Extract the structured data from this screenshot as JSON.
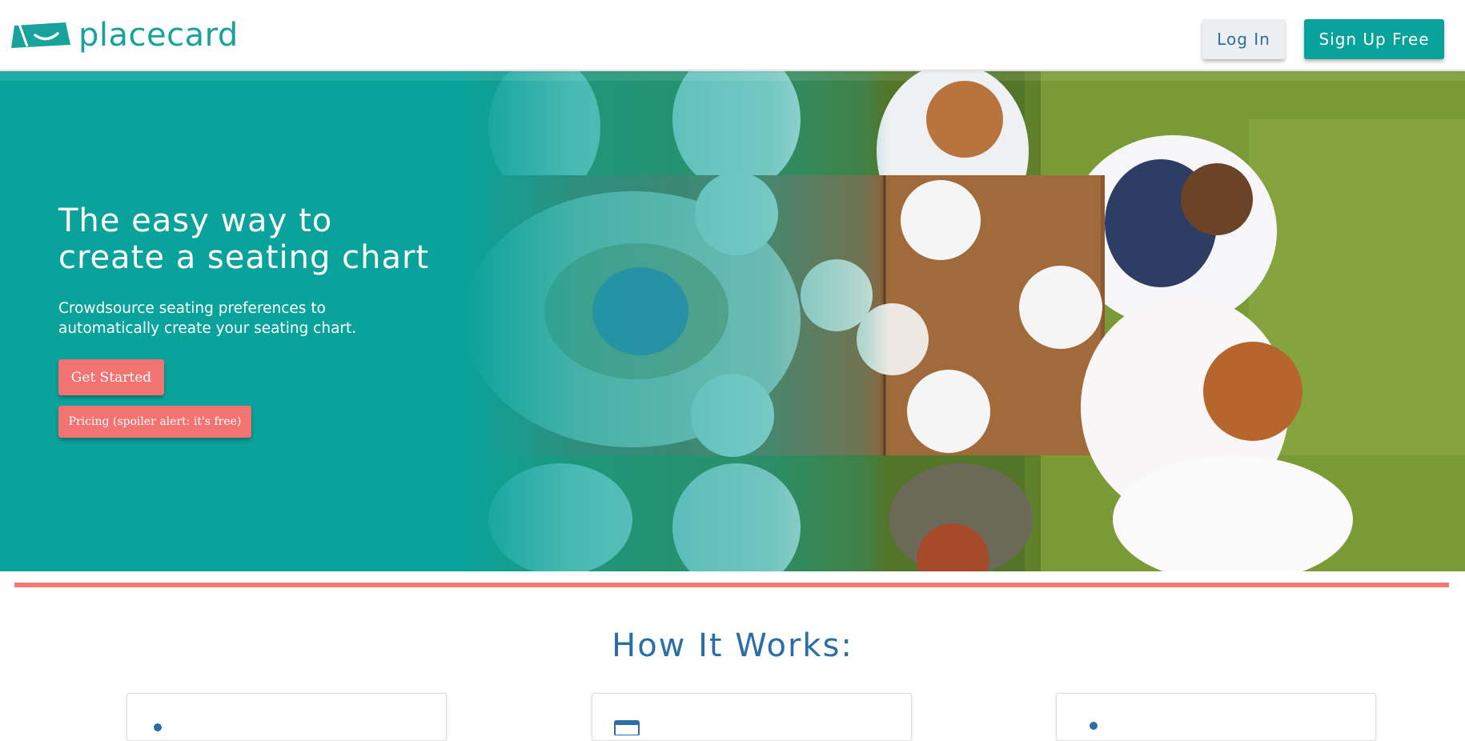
{
  "header": {
    "logo_text": "placecard",
    "login_label": "Log In",
    "signup_label": "Sign Up Free"
  },
  "hero": {
    "title": "The easy way to create a seating chart",
    "subtitle": "Crowdsource seating preferences to automatically create your seating chart.",
    "get_started_label": "Get Started",
    "pricing_label": "Pricing (spoiler alert: it's free)"
  },
  "how_it_works": {
    "title": "How It Works:",
    "cards": [
      {
        "icon": "person-icon"
      },
      {
        "icon": "browser-window-icon"
      },
      {
        "icon": "person-pin-icon"
      }
    ]
  },
  "colors": {
    "brand_teal": "#0aa39b",
    "accent_coral": "#f37373",
    "heading_blue": "#2a6ea8",
    "login_text": "#2f6d9e"
  }
}
